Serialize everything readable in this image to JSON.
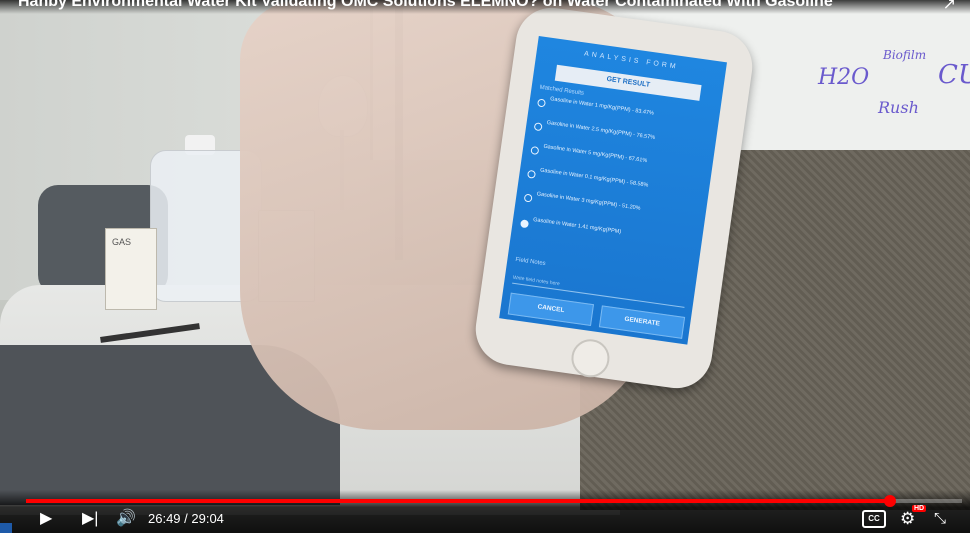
{
  "video": {
    "title": "Hanby Environmental Water Kit Validating OMC Solutions ELEMNO? on Water Contaminated With Gasoline",
    "whiteboard_notes": [
      "H2O",
      "Biofilm",
      "CU",
      "Rush"
    ],
    "jug_label": "GAS",
    "phone_app": {
      "header": "ANALYSIS FORM",
      "get_result_label": "GET RESULT",
      "matched_results_label": "Matched Results",
      "options": [
        {
          "text": "Gasoline in Water 1 mg/Kg(PPM) - 83.47%",
          "selected": false
        },
        {
          "text": "Gasoline in Water 2.5 mg/Kg(PPM) - 76.57%",
          "selected": false
        },
        {
          "text": "Gasoline in Water 5 mg/Kg(PPM) - 67.61%",
          "selected": false
        },
        {
          "text": "Gasoline in Water 0.1 mg/Kg(PPM) - 58.58%",
          "selected": false
        },
        {
          "text": "Gasoline in Water 3 mg/Kg(PPM) - 51.20%",
          "selected": false
        },
        {
          "text": "Gasoline in Water 1.41 mg/Kg(PPM)",
          "selected": true
        }
      ],
      "field_notes_label": "Field Notes",
      "field_notes_placeholder": "Write field notes here",
      "cancel_label": "CANCEL",
      "generate_label": "GENERATE"
    }
  },
  "player": {
    "current_time": "26:49",
    "duration": "29:04",
    "time_display": "26:49 / 29:04",
    "progress": 0.923,
    "cc_label": "CC",
    "hd_label": "HD",
    "accent_color": "#ff0000",
    "icons": {
      "play": "play-icon",
      "next": "next-icon",
      "volume": "volume-icon",
      "settings": "gear-icon",
      "fullscreen_exit": "exit-fullscreen-icon",
      "share": "share-icon"
    }
  }
}
